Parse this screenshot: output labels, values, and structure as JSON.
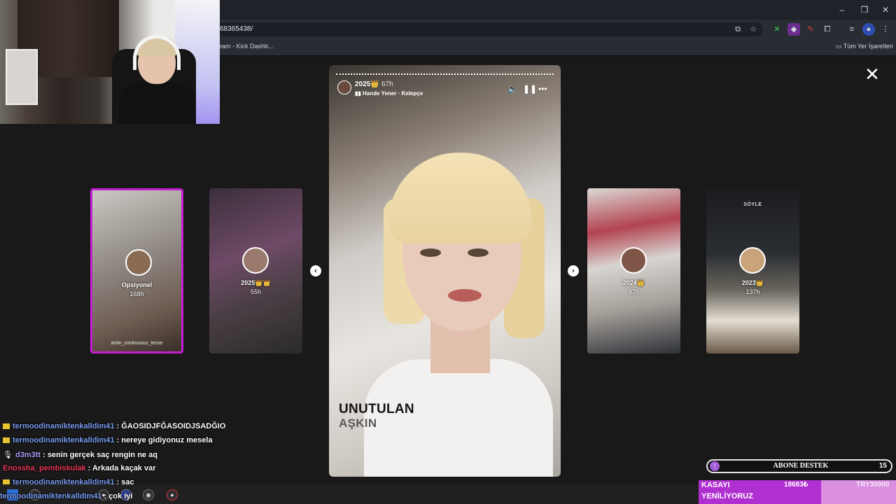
{
  "browser": {
    "url_partial": "68365438/",
    "bookmarks": [
      "eam - Kick Dashb...",
      "Tüm Yer İşaretleri"
    ],
    "window_buttons": [
      "–",
      "❐",
      "✕"
    ]
  },
  "story_viewer": {
    "close_label": "✕",
    "prev_label": "‹",
    "next_label": "›",
    "side_stories": [
      {
        "title": "Opsiyonel",
        "age": "168h",
        "author": "antin_continuous_tense"
      },
      {
        "title": "2025👑👑",
        "age": "55h"
      },
      {
        "title": "2024👑",
        "age": "87h"
      },
      {
        "title": "2023👑",
        "age": "137h",
        "overlay_text": "SÖYLE"
      }
    ],
    "current": {
      "title": "2025👑",
      "age": "67h",
      "music": "Hande Yener · Kelepçe",
      "text_line1": "UNUTULAN",
      "text_line2": "AŞKIN"
    }
  },
  "chat": [
    {
      "user": "termoodinamiktenkalldim41",
      "message": "ĞAOSIDJFĞASOIDJSADĞIO",
      "color": "#7a9cf2",
      "badge": true
    },
    {
      "user": "termoodinamiktenkalldim41",
      "message": "nereye gidiyonuz mesela",
      "color": "#7a9cf2",
      "badge": true
    },
    {
      "user": "d3m3tt",
      "message": "senin gerçek saç rengin ne aq",
      "color": "#b39cf8",
      "badge": false
    },
    {
      "user": "Enossha_pembiskulak",
      "message": "Arkada kaçak var",
      "color": "#e8365a",
      "badge": false
    },
    {
      "user": "termoodinamiktenkalldim41",
      "message": "saç",
      "color": "#7a9cf2",
      "badge": true
    },
    {
      "user": "termoodinamiktenkalldim41",
      "message": "çok iyi",
      "color": "#7a9cf2",
      "badge": false
    }
  ],
  "widgets": {
    "abone_label": "ABONE DESTEK",
    "abone_count": "15",
    "abone_dot": "!",
    "kasa_line1": "KASAYI",
    "kasa_line2": "YENİLİYORUZ",
    "kasa_amount": "18683₺",
    "kasa_target": "TRY30000"
  }
}
